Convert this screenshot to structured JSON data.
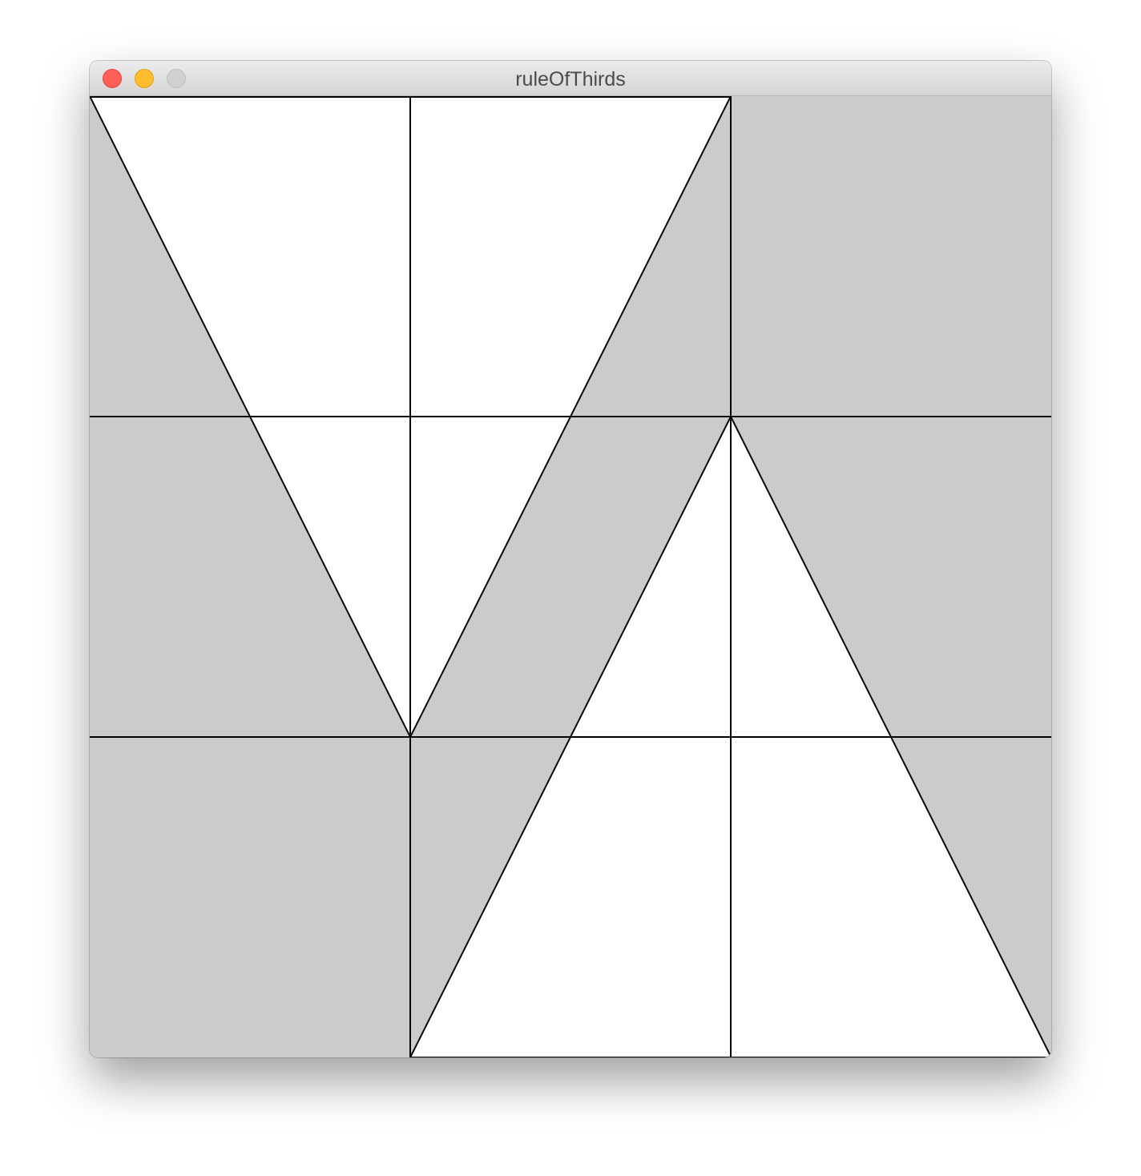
{
  "window": {
    "title": "ruleOfThirds",
    "controls": [
      "close",
      "minimize",
      "zoom"
    ]
  },
  "canvas": {
    "background_color": "#cccccc",
    "fill_color": "#ffffff",
    "stroke_color": "#000000",
    "grid_divisions": 3
  }
}
